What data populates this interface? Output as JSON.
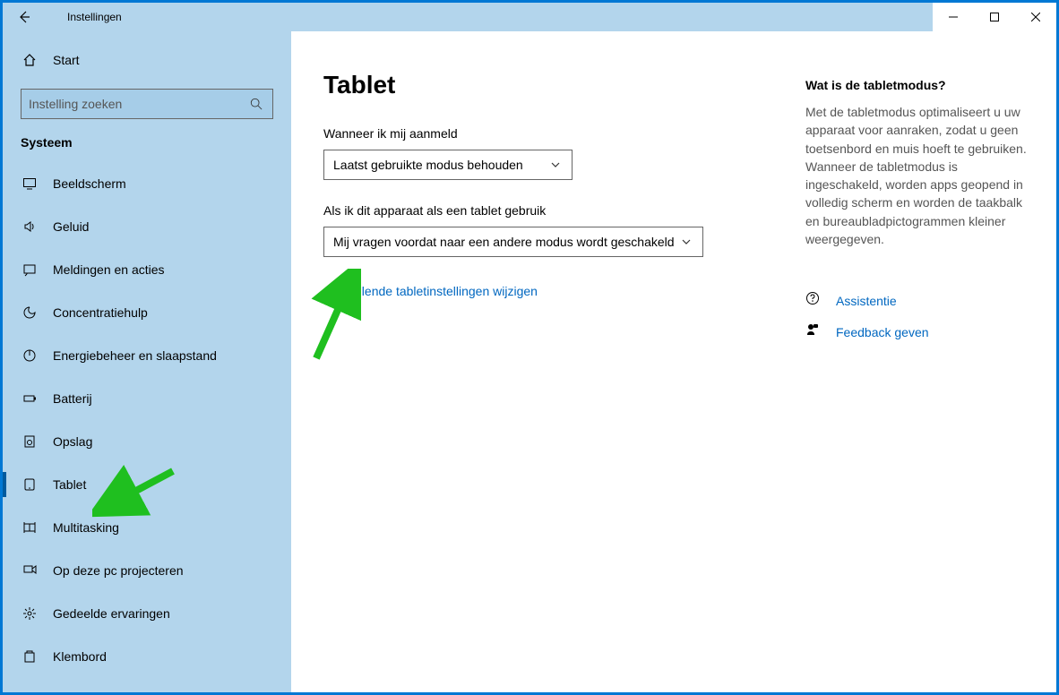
{
  "window": {
    "title": "Instellingen"
  },
  "sidebar": {
    "home_label": "Start",
    "search_placeholder": "Instelling zoeken",
    "category": "Systeem",
    "items": [
      {
        "label": "Beeldscherm"
      },
      {
        "label": "Geluid"
      },
      {
        "label": "Meldingen en acties"
      },
      {
        "label": "Concentratiehulp"
      },
      {
        "label": "Energiebeheer en slaapstand"
      },
      {
        "label": "Batterij"
      },
      {
        "label": "Opslag"
      },
      {
        "label": "Tablet"
      },
      {
        "label": "Multitasking"
      },
      {
        "label": "Op deze pc projecteren"
      },
      {
        "label": "Gedeelde ervaringen"
      },
      {
        "label": "Klembord"
      }
    ],
    "selected_index": 7
  },
  "page": {
    "title": "Tablet",
    "field1_label": "Wanneer ik mij aanmeld",
    "field1_value": "Laatst gebruikte modus behouden",
    "field2_label": "Als ik dit apparaat als een tablet gebruik",
    "field2_value": "Mij vragen voordat naar een andere modus wordt geschakeld",
    "extra_link": "Aanvullende tabletinstellingen wijzigen"
  },
  "aside": {
    "heading": "Wat is de tabletmodus?",
    "body": "Met de tabletmodus optimaliseert u uw apparaat voor aanraken, zodat u geen toetsenbord en muis hoeft te gebruiken. Wanneer de tabletmodus is ingeschakeld, worden apps geopend in volledig scherm en worden de taakbalk en bureaubladpictogrammen kleiner weergegeven.",
    "help_label": "Assistentie",
    "feedback_label": "Feedback geven"
  }
}
